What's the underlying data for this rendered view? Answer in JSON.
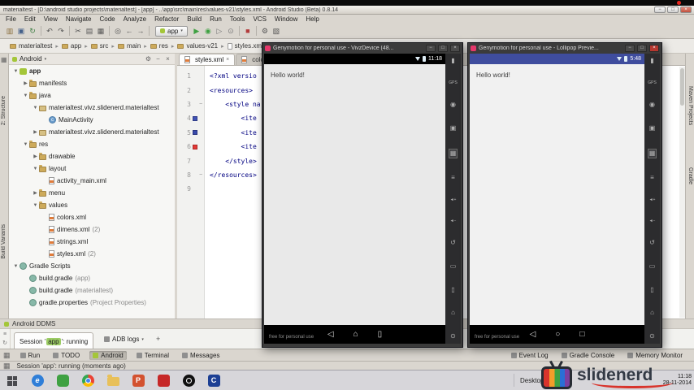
{
  "icons": {
    "minimize": "−",
    "maximize": "□",
    "close": "×",
    "caret_down": "▾",
    "crumb_sep": "▸",
    "fold": "−",
    "gear": "⚙",
    "collapse_all": "−",
    "hide": "×",
    "corner": "▦",
    "plus": "+",
    "strip_menu": "≡",
    "strip_refresh": "↻"
  },
  "window": {
    "title": "materialtest - [D:\\android studio projects\\materialtest] - [app] - ..\\app\\src\\main\\res\\values-v21\\styles.xml - Android Studio (Beta) 0.8.14"
  },
  "menubar": {
    "items": [
      "File",
      "Edit",
      "View",
      "Navigate",
      "Code",
      "Analyze",
      "Refactor",
      "Build",
      "Run",
      "Tools",
      "VCS",
      "Window",
      "Help"
    ]
  },
  "toolbar": {
    "run_config_label": "app",
    "icons_left": [
      {
        "name": "open-icon",
        "glyph": "▥",
        "color": "#8a6d3b"
      },
      {
        "name": "save-all-icon",
        "glyph": "▣",
        "color": "#44608a"
      },
      {
        "name": "sync-icon",
        "glyph": "↻",
        "color": "#3f7f44"
      },
      {
        "sep": true
      },
      {
        "name": "undo-icon",
        "glyph": "↶",
        "color": "#555555"
      },
      {
        "name": "redo-icon",
        "glyph": "↷",
        "color": "#555555"
      },
      {
        "sep": true
      },
      {
        "name": "cut-icon",
        "glyph": "✂",
        "color": "#555555"
      },
      {
        "name": "copy-icon",
        "glyph": "▤",
        "color": "#555555"
      },
      {
        "name": "paste-icon",
        "glyph": "▦",
        "color": "#555555"
      },
      {
        "sep": true
      },
      {
        "name": "find-icon",
        "glyph": "◎",
        "color": "#555555"
      },
      {
        "name": "back-arrow-icon",
        "glyph": "←",
        "color": "#555555"
      },
      {
        "name": "forward-arrow-icon",
        "glyph": "→",
        "color": "#555555"
      },
      {
        "sep": true
      }
    ],
    "icons_right": [
      {
        "name": "run-icon",
        "glyph": "▶",
        "color": "#3fa142"
      },
      {
        "name": "debug-icon",
        "glyph": "◉",
        "color": "#3fa142"
      },
      {
        "name": "run-coverage-icon",
        "glyph": "▷",
        "color": "#777777"
      },
      {
        "name": "attach-debugger-icon",
        "glyph": "⊙",
        "color": "#777777"
      },
      {
        "sep": true
      },
      {
        "name": "stop-icon",
        "glyph": "■",
        "color": "#b23b3b"
      },
      {
        "sep": true
      },
      {
        "name": "settings-icon",
        "glyph": "⚙",
        "color": "#555555"
      },
      {
        "name": "project-structure-icon",
        "glyph": "▧",
        "color": "#555555"
      }
    ]
  },
  "navbar": {
    "crumbs": [
      "materialtest",
      "app",
      "src",
      "main",
      "res",
      "values-v21",
      "styles.xml"
    ]
  },
  "left_stripe": {
    "labels": [
      "2: Structure",
      "Build Variants"
    ]
  },
  "right_stripe": {
    "labels": [
      "Maven Projects",
      "Gradle"
    ]
  },
  "project": {
    "view": "Android",
    "tree": [
      {
        "label": "app",
        "level": 0,
        "expander": "▼",
        "icon": "android",
        "bold": true
      },
      {
        "label": "manifests",
        "level": 1,
        "expander": "▶",
        "icon": "folder"
      },
      {
        "label": "java",
        "level": 1,
        "expander": "▼",
        "icon": "folder"
      },
      {
        "label": "materialtest.vivz.slidenerd.materialtest",
        "level": 2,
        "expander": "▼",
        "icon": "package"
      },
      {
        "label": "MainActivity",
        "level": 3,
        "expander": "",
        "icon": "class"
      },
      {
        "label": "materialtest.vivz.slidenerd.materialtest",
        "level": 2,
        "expander": "▶",
        "icon": "package"
      },
      {
        "label": "res",
        "level": 1,
        "expander": "▼",
        "icon": "folder"
      },
      {
        "label": "drawable",
        "level": 2,
        "expander": "▶",
        "icon": "folder"
      },
      {
        "label": "layout",
        "level": 2,
        "expander": "▼",
        "icon": "folder"
      },
      {
        "label": "activity_main.xml",
        "level": 3,
        "expander": "",
        "icon": "file"
      },
      {
        "label": "menu",
        "level": 2,
        "expander": "▶",
        "icon": "folder"
      },
      {
        "label": "values",
        "level": 2,
        "expander": "▼",
        "icon": "folder"
      },
      {
        "label": "colors.xml",
        "level": 3,
        "expander": "",
        "icon": "file"
      },
      {
        "label": "dimens.xml",
        "suffix": "(2)",
        "level": 3,
        "expander": "",
        "icon": "file"
      },
      {
        "label": "strings.xml",
        "level": 3,
        "expander": "",
        "icon": "file"
      },
      {
        "label": "styles.xml",
        "suffix": "(2)",
        "level": 3,
        "expander": "",
        "icon": "file"
      },
      {
        "label": "Gradle Scripts",
        "level": 0,
        "expander": "▼",
        "icon": "gradle"
      },
      {
        "label": "build.gradle",
        "suffix": "(app)",
        "level": 1,
        "expander": "",
        "icon": "gradle"
      },
      {
        "label": "build.gradle",
        "suffix": "(materialtest)",
        "level": 1,
        "expander": "",
        "icon": "gradle"
      },
      {
        "label": "gradle.properties",
        "suffix": "(Project Properties)",
        "level": 1,
        "expander": "",
        "icon": "gradle"
      }
    ]
  },
  "editor": {
    "tabs": [
      {
        "label": "styles.xml"
      },
      {
        "label": "colors.xml"
      }
    ],
    "lines": [
      {
        "n": "1",
        "code": "<?xml versio"
      },
      {
        "n": "2",
        "code": "<resources>"
      },
      {
        "n": "3",
        "code": "    <style na",
        "fold": true
      },
      {
        "n": "4",
        "code": "        <ite",
        "swatch": "#3f51b5"
      },
      {
        "n": "5",
        "code": "        <ite",
        "swatch": "#3949ab"
      },
      {
        "n": "6",
        "code": "        <ite",
        "swatch": "#e53935"
      },
      {
        "n": "7",
        "code": "    </style>"
      },
      {
        "n": "8",
        "code": "</resources>",
        "fold": true
      },
      {
        "n": "9",
        "code": ""
      }
    ]
  },
  "emulator1": {
    "title": "Genymotion for personal use - VivzDevice (48...",
    "statusbar_time": "11:18",
    "app_text": "Hello world!",
    "watermark": "free for personal use",
    "nav_icons": [
      {
        "name": "back-icon",
        "glyph": "◁"
      },
      {
        "name": "home-icon",
        "glyph": "⌂"
      },
      {
        "name": "recents-icon",
        "glyph": "▯"
      }
    ]
  },
  "emulator2": {
    "title": "Genymotion for personal use - Lollipop Previe...",
    "statusbar_time": "5:48",
    "app_text": "Hello world!",
    "watermark": "free for personal use",
    "nav_icons": [
      {
        "name": "back-icon",
        "glyph": "◁"
      },
      {
        "name": "home-icon",
        "glyph": "○"
      },
      {
        "name": "recents-icon",
        "glyph": "□"
      }
    ]
  },
  "genymotion_sidebar_icons": [
    {
      "name": "battery-icon",
      "glyph": "▮"
    },
    {
      "name": "gps-icon",
      "glyph": "GPS",
      "small": true
    },
    {
      "name": "camera-icon",
      "glyph": "◉"
    },
    {
      "name": "screencast-icon",
      "glyph": "▣"
    },
    {
      "name": "remote-icon",
      "glyph": "▦",
      "active": true
    },
    {
      "name": "identifiers-icon",
      "glyph": "≡"
    },
    {
      "name": "volume-up-icon",
      "glyph": "◄+",
      "small": true
    },
    {
      "name": "volume-down-icon",
      "glyph": "◄−",
      "small": true
    },
    {
      "name": "rotate-icon",
      "glyph": "↺"
    },
    {
      "name": "navbar-toggle-icon",
      "glyph": "▭"
    },
    {
      "name": "recent-apps-icon",
      "glyph": "▯"
    },
    {
      "name": "home-icon",
      "glyph": "⌂"
    },
    {
      "name": "power-icon",
      "glyph": "⊙"
    }
  ],
  "ddms": {
    "title": "Android DDMS",
    "session_prefix": "Session '",
    "session_app": "app",
    "session_suffix": "': running",
    "adb_logs_label": "ADB logs",
    "add_label": "+"
  },
  "toolwindows": {
    "active": "Android",
    "left": [
      "Run",
      "TODO",
      "Android",
      "Terminal",
      "Messages"
    ],
    "right": [
      "Event Log",
      "Gradle Console",
      "Memory Monitor"
    ]
  },
  "statusbar": {
    "text": "Session 'app': running (moments ago)"
  },
  "taskbar": {
    "desktop_label": "Desktop",
    "clock_time": "11:18",
    "clock_date": "28-11-2014",
    "apps": [
      {
        "name": "internet-explorer-icon",
        "style": "ie",
        "letter": "e"
      },
      {
        "name": "green-app-icon",
        "style": "green"
      },
      {
        "name": "chrome-icon",
        "style": "chrome"
      },
      {
        "name": "file-explorer-icon",
        "style": "folder"
      },
      {
        "name": "powerpoint-icon",
        "style": "ppt",
        "letter": "P"
      },
      {
        "name": "red-app-icon",
        "style": "red"
      },
      {
        "name": "obs-icon",
        "style": "obs"
      },
      {
        "name": "cmd-icon",
        "style": "cmd",
        "letter": "C"
      }
    ]
  },
  "logo": {
    "text": "slidenerd"
  }
}
